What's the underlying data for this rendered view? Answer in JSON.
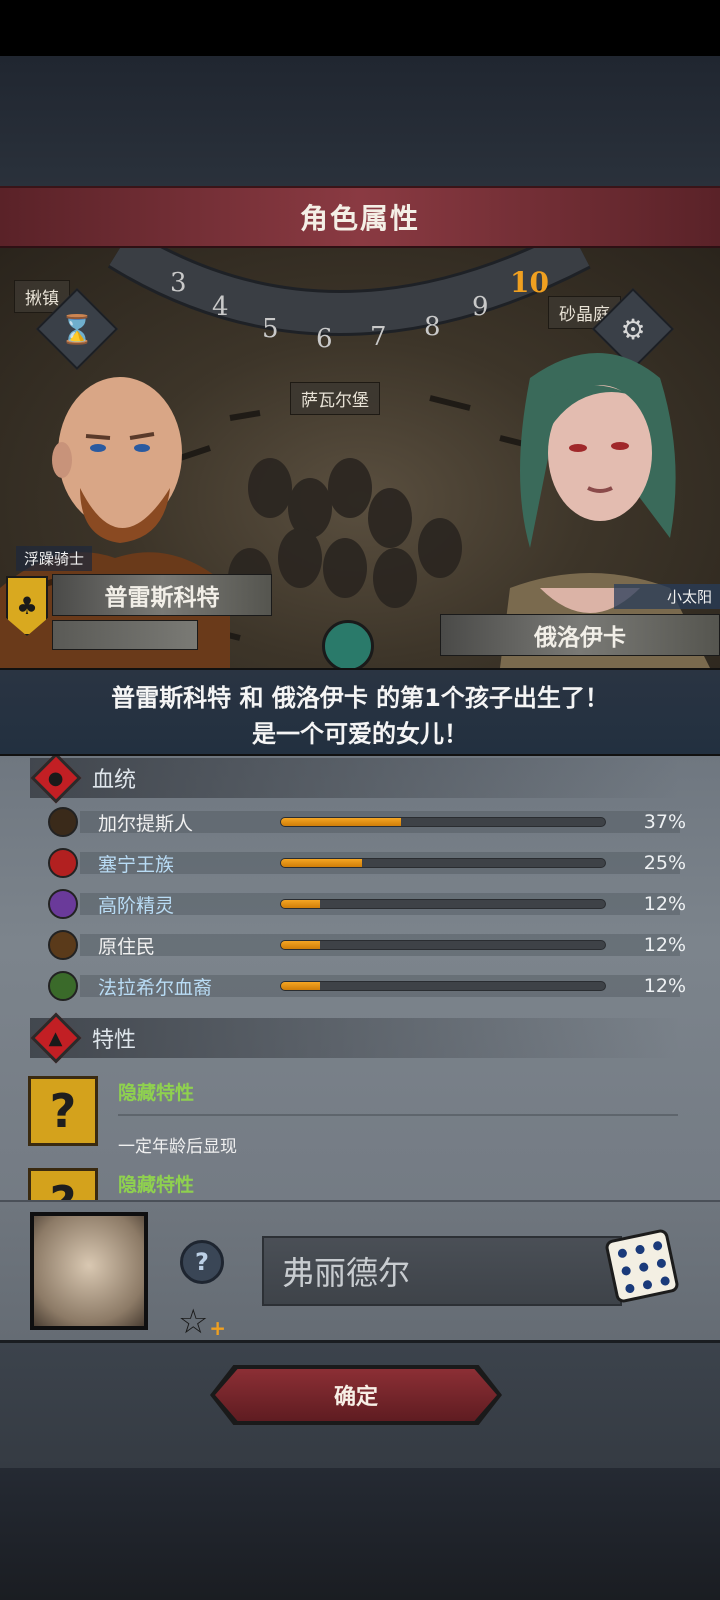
{
  "header": {
    "title": "角色属性"
  },
  "map": {
    "labels": [
      "揪镇",
      "萨瓦尔堡",
      "砂晶庭"
    ],
    "dial_numbers": [
      "3",
      "4",
      "5",
      "6",
      "7",
      "8",
      "9",
      "10"
    ],
    "current_day": "10"
  },
  "father": {
    "title": "浮躁骑士",
    "name": "普雷斯科特"
  },
  "mother": {
    "title": "小太阳",
    "name": "俄洛伊卡"
  },
  "announcement": {
    "line1": "普雷斯科特 和 俄洛伊卡 的第1个孩子出生了！",
    "line2": "是一个可爱的女儿！"
  },
  "bloodline": {
    "heading": "血统",
    "items": [
      {
        "name": "加尔提斯人",
        "percent_text": "37%",
        "value": 37,
        "name_color": "#f0f0f0",
        "emblem_color": "#3a2a1a"
      },
      {
        "name": "塞宁王族",
        "percent_text": "25%",
        "value": 25,
        "name_color": "#b9dcf5",
        "emblem_color": "#b22020"
      },
      {
        "name": "高阶精灵",
        "percent_text": "12%",
        "value": 12,
        "name_color": "#b9dcf5",
        "emblem_color": "#6a3a9a"
      },
      {
        "name": "原住民",
        "percent_text": "12%",
        "value": 12,
        "name_color": "#f0f0f0",
        "emblem_color": "#5a3a1a"
      },
      {
        "name": "法拉希尔血裔",
        "percent_text": "12%",
        "value": 12,
        "name_color": "#b9dcf5",
        "emblem_color": "#3a6a2a"
      }
    ]
  },
  "traits": {
    "heading": "特性",
    "items": [
      {
        "name": "隐藏特性",
        "desc": "一定年龄后显现"
      },
      {
        "name": "隐藏特性",
        "desc": ""
      }
    ]
  },
  "baby": {
    "name_value": "弗丽德尔",
    "help_icon": "question-icon",
    "favorite_icon": "star-plus-icon",
    "random_icon": "dice-icon"
  },
  "footer": {
    "confirm_label": "确定"
  }
}
